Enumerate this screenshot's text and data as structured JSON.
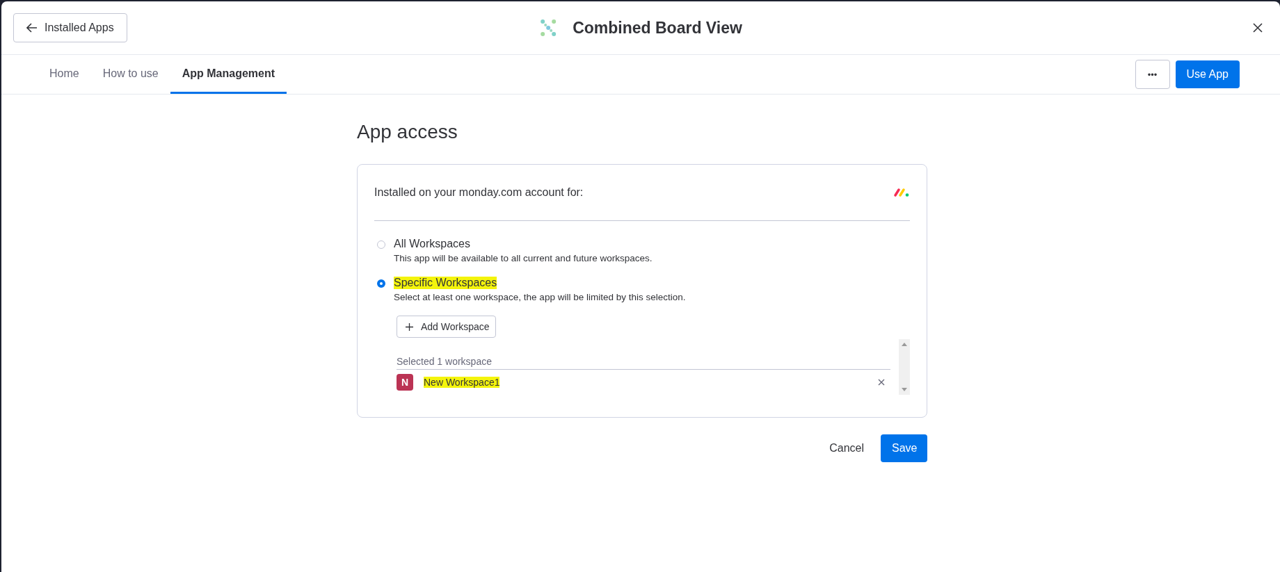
{
  "header": {
    "back_button": "Installed Apps",
    "title": "Combined Board View"
  },
  "tabs": [
    {
      "label": "Home",
      "selected": false
    },
    {
      "label": "How to use",
      "selected": false
    },
    {
      "label": "App Management",
      "selected": true
    }
  ],
  "toolbar": {
    "more_button": "•••",
    "primary_button": "Use App"
  },
  "page_title": "App access",
  "card": {
    "heading": "Installed on your monday.com account for:",
    "options": [
      {
        "label": "All Workspaces",
        "description": "This app will be available to all current and future workspaces.",
        "selected": false,
        "highlighted": false
      },
      {
        "label": "Specific Workspaces",
        "description": "Select at least one workspace, the app will be limited by this selection.",
        "selected": true,
        "highlighted": true
      }
    ],
    "add_button": "Add Workspace",
    "selected_caption": "Selected 1 workspace",
    "workspaces": [
      {
        "initial": "N",
        "name": "New Workspace1",
        "color": "#bb3354",
        "highlighted": true
      }
    ]
  },
  "actions": {
    "cancel": "Cancel",
    "save": "Save"
  }
}
